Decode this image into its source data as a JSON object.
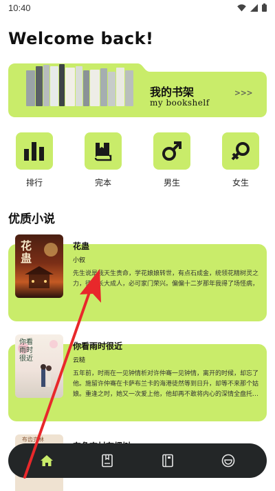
{
  "status": {
    "time": "10:40",
    "icons": [
      "wifi-icon",
      "signal-icon",
      "battery-icon"
    ]
  },
  "header": {
    "welcome": "Welcome back!"
  },
  "bookshelf": {
    "title": "我的书架",
    "subtitle": "my bookshelf",
    "arrows": ">>>"
  },
  "categories": [
    {
      "label": "排行",
      "icon": "bar-chart-icon"
    },
    {
      "label": "完本",
      "icon": "book-icon"
    },
    {
      "label": "男生",
      "icon": "male-icon"
    },
    {
      "label": "女生",
      "icon": "female-icon"
    }
  ],
  "section": {
    "title": "优质小说"
  },
  "novels": [
    {
      "title": "花蛊",
      "author": "小叙",
      "cover_text": "花蛊",
      "desc": "先生说是我天生贵命，学花娘娘转世，有点石成金，统领花精树灵之力，待我长大成人，必可家门荣兴。偏偏十二岁那年我得了场怪病，高烧不退，差着到哪人的目象……梦里我遇到个婆婆，她说找手眼满…"
    },
    {
      "title": "你看雨时很近",
      "author": "云糙",
      "cover_text": "你看雨时很近",
      "desc": "五年前，时雨在一见钟情析对许仲骞一见钟情，离开的时候，却忘了他。施留许仲骞在卡萨布兰卡的海港徒然等到日升，却等不来那个姑娘。重逢之时，她又一次爱上他，他却再不敢将内心的深情全盘托…"
    },
    {
      "title": "东角吉村有棵树",
      "author": "",
      "cover_text": "布齿克林",
      "desc": ""
    }
  ],
  "nav": [
    {
      "icon": "home-icon",
      "active": true
    },
    {
      "icon": "bookmark-icon",
      "active": false
    },
    {
      "icon": "notebook-icon",
      "active": false
    },
    {
      "icon": "profile-icon",
      "active": false
    }
  ],
  "colors": {
    "accent": "#c9ec6a",
    "nav_bg": "#232627",
    "active_icon": "#c9ec6a",
    "annotation": "#e8282b"
  }
}
